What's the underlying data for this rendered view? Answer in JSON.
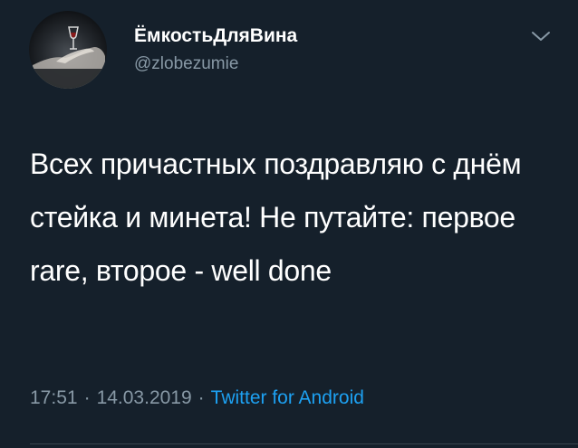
{
  "tweet": {
    "display_name": "ЁмкостьДляВина",
    "handle": "@zlobezumie",
    "text": "Всех причастных поздравляю с днём стейка и минета! Не путайте: первое rare, второе - well done",
    "time": "17:51",
    "date": "14.03.2019",
    "separator": "·",
    "source": "Twitter for Android",
    "menu_icon": "chevron-down-icon",
    "avatar_icon": "avatar-photo"
  },
  "colors": {
    "background": "#15202b",
    "primary_text": "#ffffff",
    "secondary_text": "#8899a6",
    "link": "#1da1f2",
    "divider": "#38444d"
  }
}
